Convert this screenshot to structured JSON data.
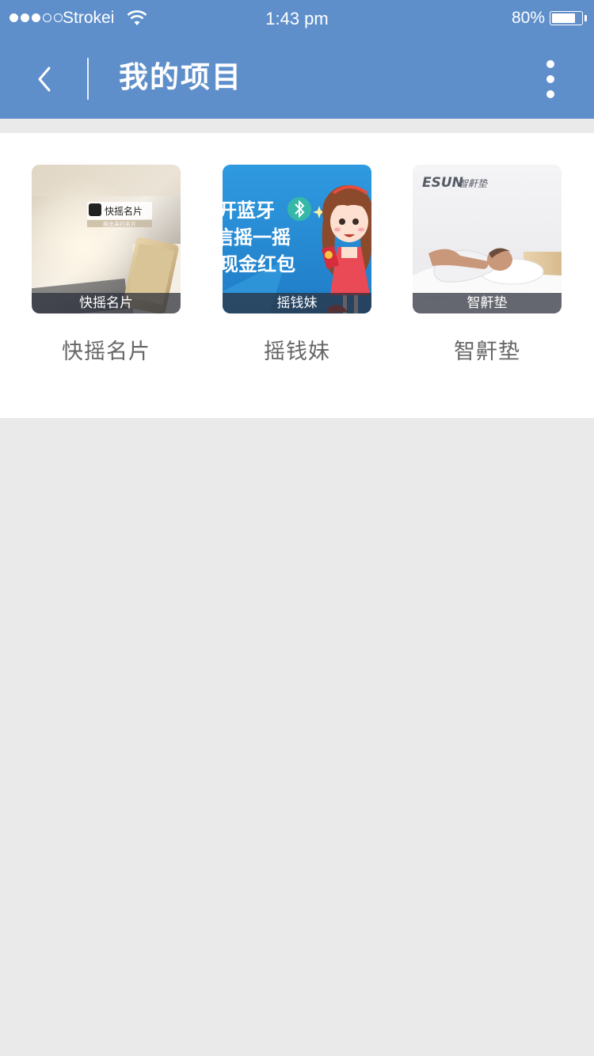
{
  "status_bar": {
    "carrier": "Strokei",
    "time": "1:43 pm",
    "battery_percent": "80%",
    "battery_level": 0.8,
    "signal_bars_filled": 3,
    "signal_bars_total": 5
  },
  "nav": {
    "back_icon": "chevron-left-icon",
    "title": "我的项目",
    "more_icon": "vertical-ellipsis-icon"
  },
  "colors": {
    "header_bg": "#5f8fcb",
    "page_bg": "#eaeaea",
    "panel_bg": "#ffffff",
    "label_text": "#666666"
  },
  "projects": [
    {
      "name": "快摇名片",
      "thumb_caption": "快摇名片",
      "thumb_logo_text": "快摇名片",
      "thumb_logo_subtext": "摇出来的名片"
    },
    {
      "name": "摇钱妹",
      "thumb_caption": "摇钱妹",
      "thumb_text_lines": [
        "开蓝牙",
        "信摇一摇",
        "现金红包"
      ]
    },
    {
      "name": "智鼾垫",
      "thumb_caption": "智鼾垫",
      "thumb_brand": "ESUN",
      "thumb_brand_cn": "智鼾垫"
    }
  ]
}
